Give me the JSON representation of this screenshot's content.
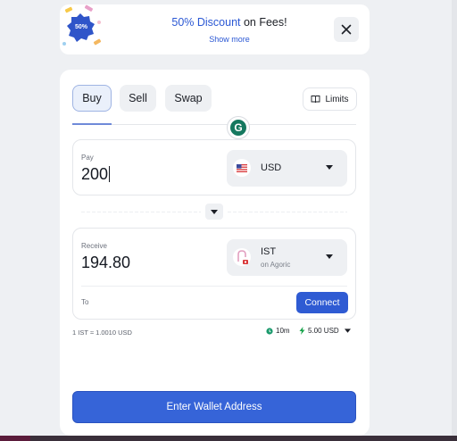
{
  "promo": {
    "badge": "50%",
    "highlight": "50% Discount",
    "rest": " on Fees!",
    "show_more": "Show more"
  },
  "tabs": [
    {
      "label": "Buy",
      "active": true
    },
    {
      "label": "Sell",
      "active": false
    },
    {
      "label": "Swap",
      "active": false
    }
  ],
  "limits_label": "Limits",
  "grammarly_letter": "G",
  "pay": {
    "label": "Pay",
    "amount": "200",
    "currency": "USD"
  },
  "receive": {
    "label": "Receive",
    "amount": "194.80",
    "currency": "IST",
    "network": "on Agoric",
    "to_label": "To",
    "connect_label": "Connect"
  },
  "rate": "1 IST ≈ 1.0010 USD",
  "eta": "10m",
  "fee": "5.00 USD",
  "cta_label": "Enter Wallet Address",
  "colors": {
    "accent": "#3664d8",
    "link": "#2b58d4",
    "eta_icon": "#1a9a6c",
    "fee_icon": "#17a34a"
  },
  "icons": [
    "close-icon",
    "book-icon",
    "chevron-down-icon",
    "us-flag-icon",
    "ist-token-icon",
    "clock-icon",
    "lightning-icon",
    "grammarly-icon"
  ]
}
